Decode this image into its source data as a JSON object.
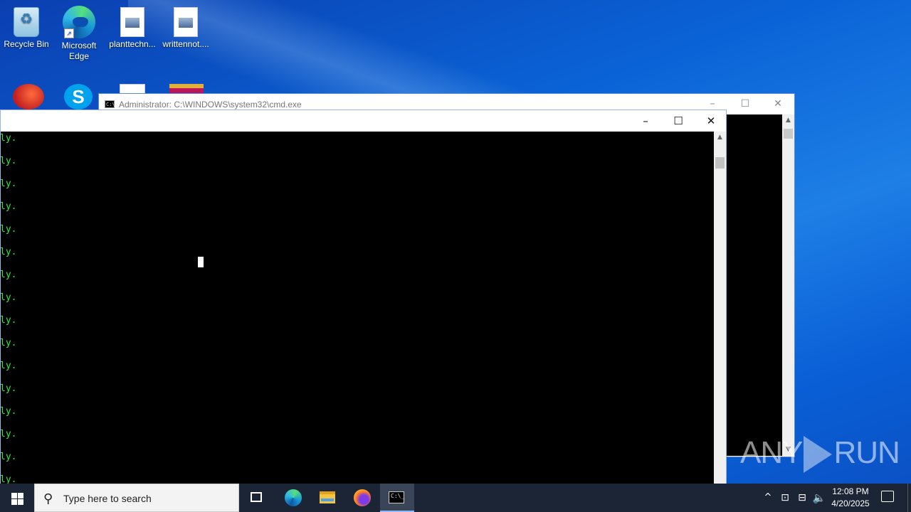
{
  "desktop": {
    "icons": [
      {
        "label": "Recycle Bin"
      },
      {
        "label": "Microsoft Edge"
      },
      {
        "label": "planttechn..."
      },
      {
        "label": "writtennot...."
      }
    ]
  },
  "background_window": {
    "title": "Administrator: C:\\WINDOWS\\system32\\cmd.exe",
    "icon": "cmd-icon",
    "minimize": "–",
    "maximize": "☐",
    "close": "✕"
  },
  "foreground_window": {
    "minimize": "–",
    "maximize": "☐",
    "close": "✕",
    "lines": [
      "ly.",
      "ly.",
      "ly.",
      "ly.",
      "ly.",
      "ly.",
      "ly.",
      "ly.",
      "ly.",
      "ly.",
      "ly.",
      "ly.",
      "ly.",
      "ly.",
      "ly.",
      "ly."
    ],
    "text_color": "#39e83a"
  },
  "watermark": {
    "left": "ANY",
    "right": "RUN"
  },
  "taskbar": {
    "search_placeholder": "Type here to search",
    "clock_time": "12:08 PM",
    "clock_date": "4/20/2025",
    "tray_chevron": "^"
  }
}
